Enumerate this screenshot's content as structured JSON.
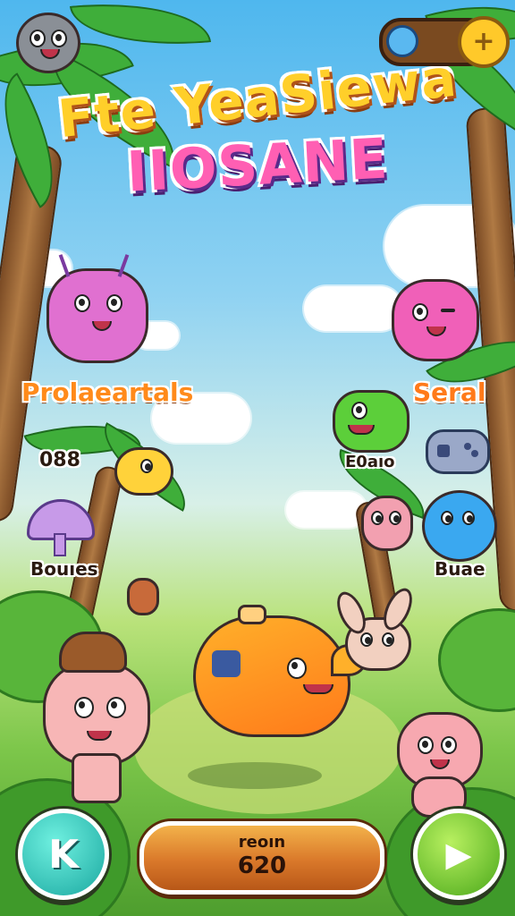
{
  "title": {
    "line1": "Fte YeaSiewa",
    "line2": "IIOSANE"
  },
  "labels": {
    "left_main": "Prolaeartals",
    "right_main": "Seral",
    "left_count": "088",
    "right_count": "E0aıo",
    "left_bottom": "Bouıes",
    "right_bottom": "Buae"
  },
  "score": {
    "label": "reoın",
    "value": "620"
  },
  "buttons": {
    "back": "K",
    "next": "▶",
    "add": "+"
  },
  "colors": {
    "sky": "#4fb7ee",
    "grass": "#7cc64a",
    "accent_orange": "#ff8a1a",
    "teal": "#2cc8b8",
    "green_btn": "#6ccf2a"
  }
}
